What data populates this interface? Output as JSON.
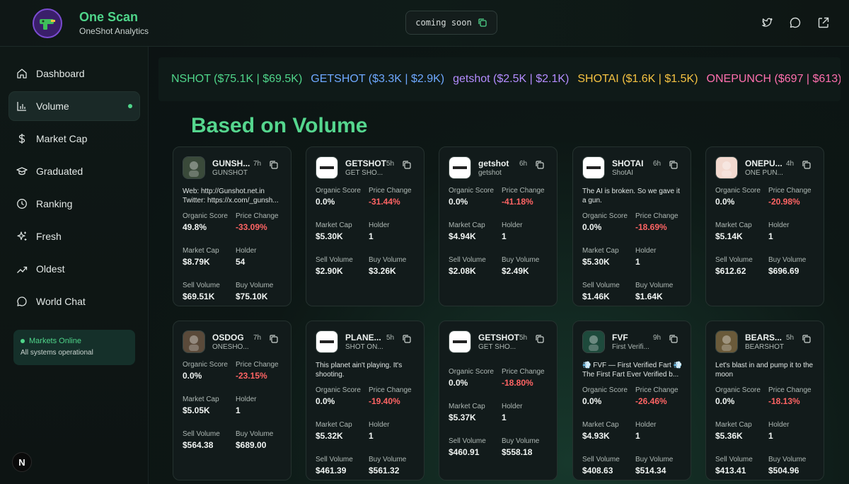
{
  "app": {
    "title": "One Scan",
    "subtitle": "OneShot Analytics"
  },
  "header": {
    "coming_soon": "coming soon"
  },
  "sidebar": {
    "items": [
      {
        "label": "Dashboard",
        "icon": "home-icon"
      },
      {
        "label": "Volume",
        "icon": "bar-chart-icon",
        "active": true
      },
      {
        "label": "Market Cap",
        "icon": "dollar-icon"
      },
      {
        "label": "Graduated",
        "icon": "graduation-cap-icon"
      },
      {
        "label": "Ranking",
        "icon": "clock-icon"
      },
      {
        "label": "Fresh",
        "icon": "sparkles-icon"
      },
      {
        "label": "Oldest",
        "icon": "trend-icon"
      },
      {
        "label": "World Chat",
        "icon": "chat-icon"
      }
    ],
    "status_title": "Markets Online",
    "status_sub": "All systems operational",
    "n_button": "N"
  },
  "ticker": [
    {
      "text": "NSHOT ($75.1K | $69.5K)",
      "color": "#4fd58a"
    },
    {
      "text": "GETSHOT ($3.3K | $2.9K)",
      "color": "#6ea8ff"
    },
    {
      "text": "getshot ($2.5K | $2.1K)",
      "color": "#b48cff"
    },
    {
      "text": "SHOTAI ($1.6K | $1.5K)",
      "color": "#f5c242"
    },
    {
      "text": "ONEPUNCH ($697 | $613)",
      "color": "#ff6fae"
    }
  ],
  "heading": "Based on Volume",
  "labels": {
    "organic": "Organic Score",
    "price": "Price Change",
    "mcap": "Market Cap",
    "holder": "Holder",
    "sell": "Sell Volume",
    "buy": "Buy Volume"
  },
  "cards": [
    {
      "name": "GUNSH...",
      "symbol": "GUNSHOT",
      "age": "7h",
      "desc": [
        "Web: http://Gunshot.net.in",
        "Twitter: https://x.com/_gunsh..."
      ],
      "organic": "49.8%",
      "price": "-33.09%",
      "mcap": "$8.79K",
      "holder": "54",
      "sell": "$69.51K",
      "buy": "$75.10K",
      "avatar_color": "#3a4a3a"
    },
    {
      "name": "GETSHOT",
      "symbol": "GET SHO...",
      "age": "5h",
      "desc": [],
      "organic": "0.0%",
      "price": "-31.44%",
      "mcap": "$5.30K",
      "holder": "1",
      "sell": "$2.90K",
      "buy": "$3.26K",
      "avatar_color": "#ffffff"
    },
    {
      "name": "getshot",
      "symbol": "getshot",
      "age": "6h",
      "desc": [],
      "organic": "0.0%",
      "price": "-41.18%",
      "mcap": "$4.94K",
      "holder": "1",
      "sell": "$2.08K",
      "buy": "$2.49K",
      "avatar_color": "#ffffff"
    },
    {
      "name": "SHOTAI",
      "symbol": "ShotAI",
      "age": "6h",
      "desc": [
        "The AI is broken. So we gave it",
        "a gun."
      ],
      "organic": "0.0%",
      "price": "-18.69%",
      "mcap": "$5.30K",
      "holder": "1",
      "sell": "$1.46K",
      "buy": "$1.64K",
      "avatar_color": "#ffffff"
    },
    {
      "name": "ONEPU...",
      "symbol": "ONE PUN...",
      "age": "4h",
      "desc": [],
      "organic": "0.0%",
      "price": "-20.98%",
      "mcap": "$5.14K",
      "holder": "1",
      "sell": "$612.62",
      "buy": "$696.69",
      "avatar_color": "#f2d9cf"
    },
    {
      "name": "OSDOG",
      "symbol": "ONESHO...",
      "age": "7h",
      "desc": [],
      "organic": "0.0%",
      "price": "-23.15%",
      "mcap": "$5.05K",
      "holder": "1",
      "sell": "$564.38",
      "buy": "$689.00",
      "avatar_color": "#5a4a3a"
    },
    {
      "name": "PLANE...",
      "symbol": "SHOT ON...",
      "age": "5h",
      "desc": [
        "This planet ain't playing. It's",
        "shooting."
      ],
      "organic": "0.0%",
      "price": "-19.40%",
      "mcap": "$5.32K",
      "holder": "1",
      "sell": "$461.39",
      "buy": "$561.32",
      "avatar_color": "#ffffff"
    },
    {
      "name": "GETSHOT",
      "symbol": "GET SHO...",
      "age": "5h",
      "desc": [],
      "organic": "0.0%",
      "price": "-18.80%",
      "mcap": "$5.37K",
      "holder": "1",
      "sell": "$460.91",
      "buy": "$558.18",
      "avatar_color": "#ffffff"
    },
    {
      "name": "FVF",
      "symbol": "First Verifi...",
      "age": "9h",
      "desc": [
        "💨 FVF — First Verified Fart 💨",
        "The First Fart Ever Verified b..."
      ],
      "organic": "0.0%",
      "price": "-26.46%",
      "mcap": "$4.93K",
      "holder": "1",
      "sell": "$408.63",
      "buy": "$514.34",
      "avatar_color": "#1e4a3c"
    },
    {
      "name": "BEARS...",
      "symbol": "BEARSHOT",
      "age": "5h",
      "desc": [
        "Let's blast in and pump it to the",
        "moon"
      ],
      "organic": "0.0%",
      "price": "-18.13%",
      "mcap": "$5.36K",
      "holder": "1",
      "sell": "$413.41",
      "buy": "$504.96",
      "avatar_color": "#6a5a3a"
    }
  ]
}
